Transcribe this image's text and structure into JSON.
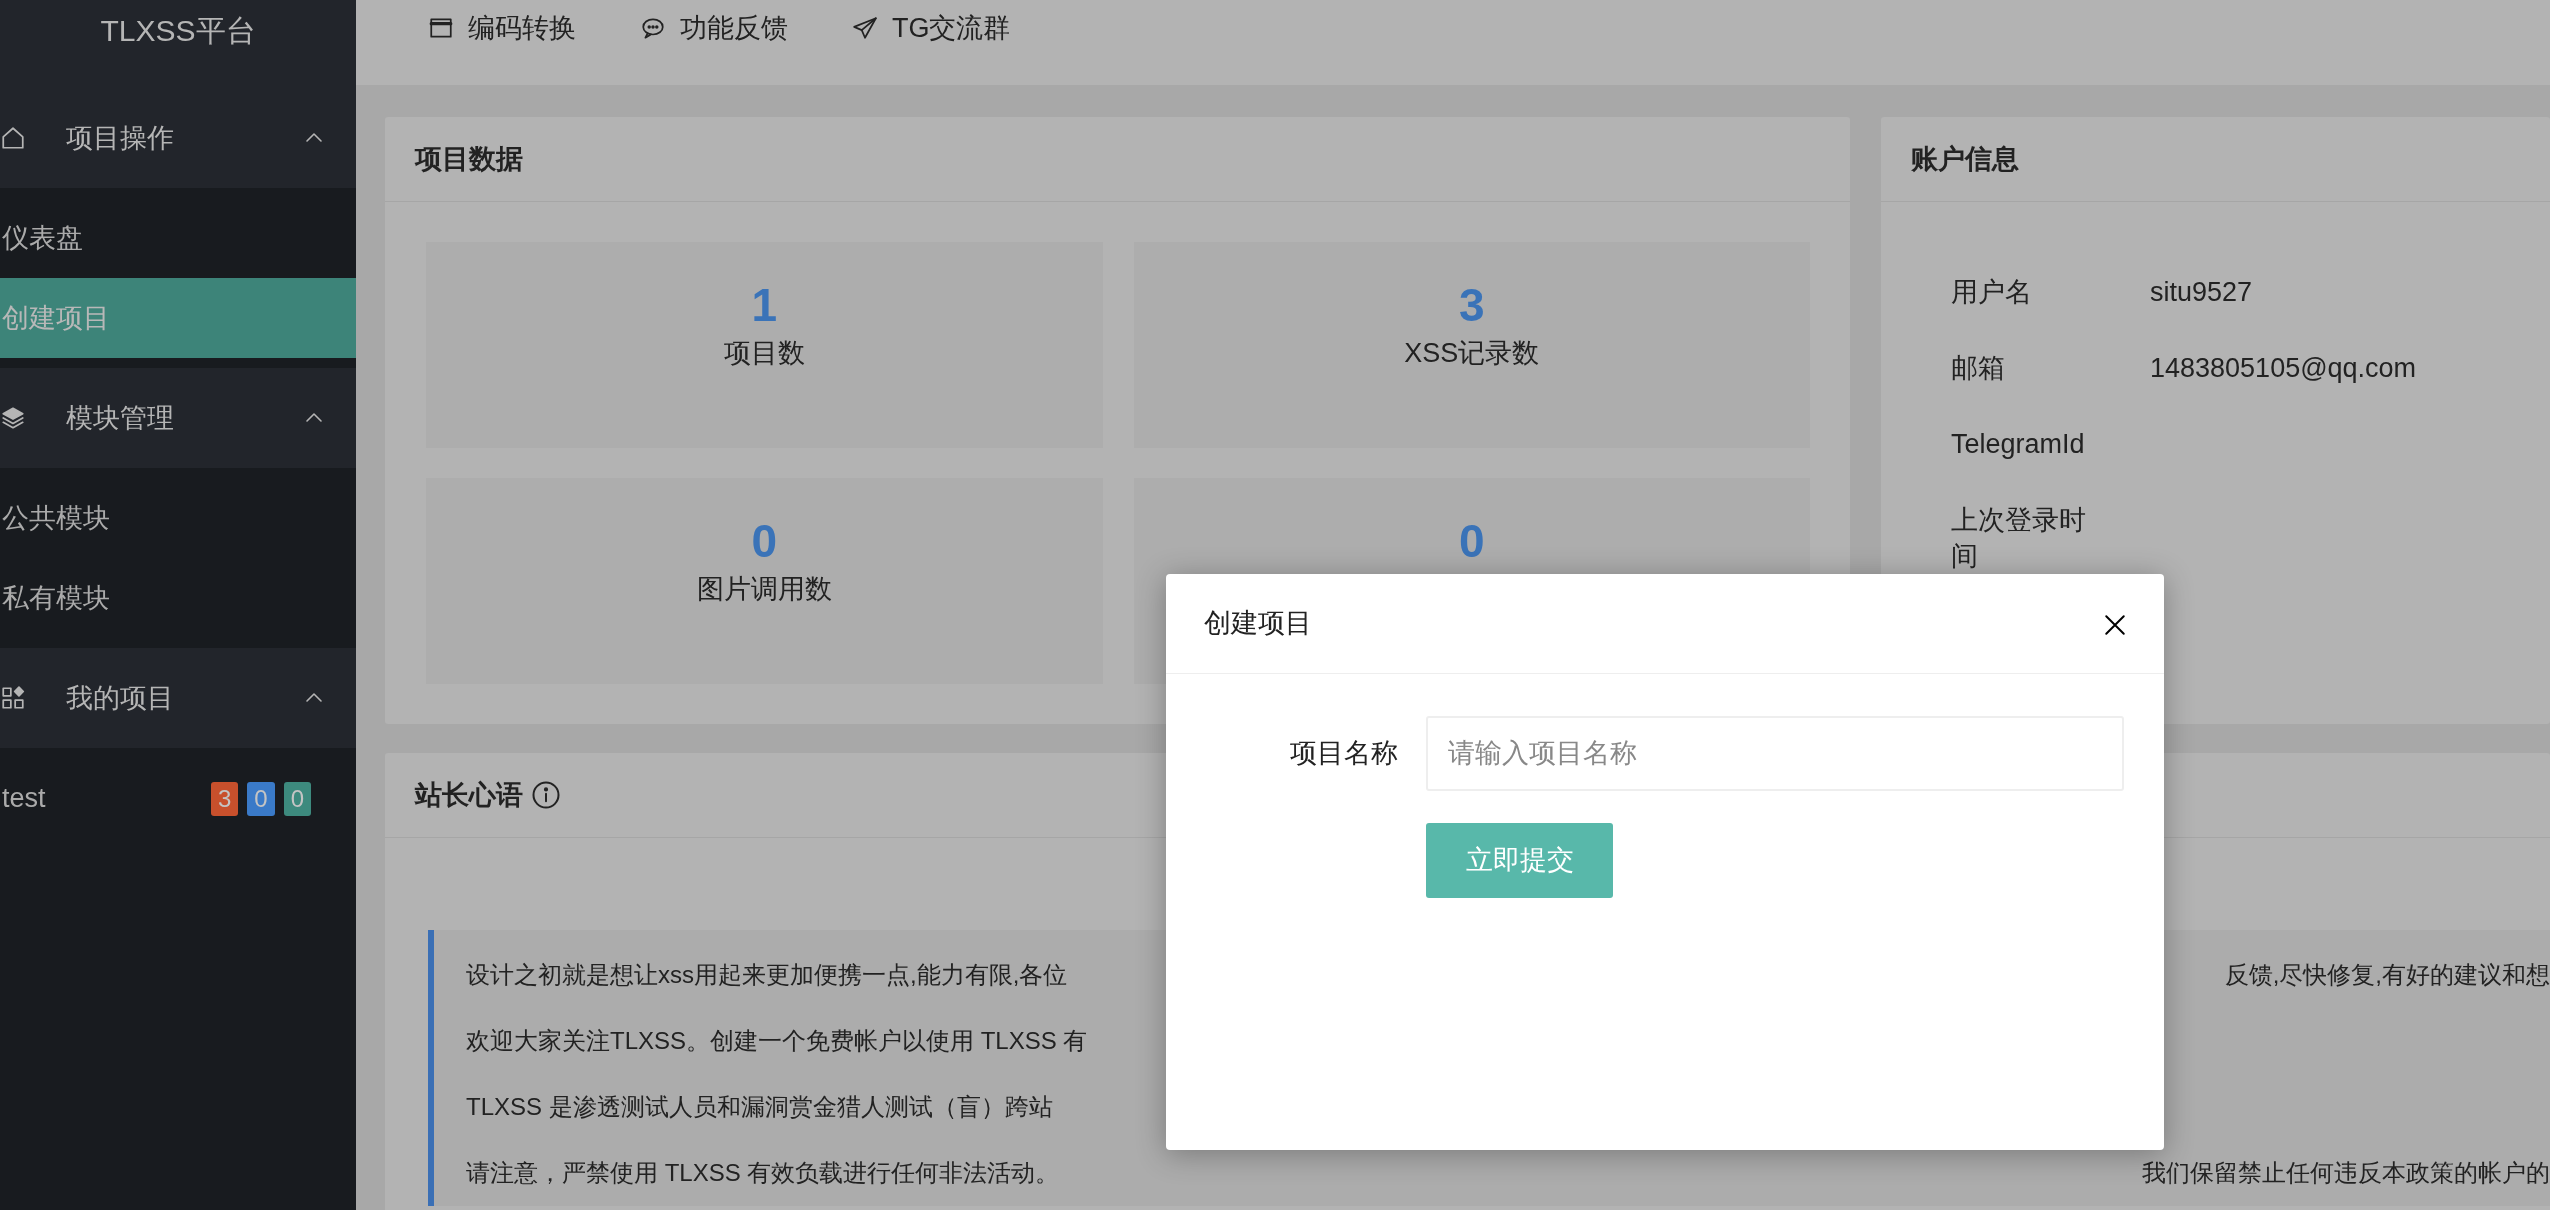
{
  "sidebar": {
    "logo": "TLXSS平台",
    "sections": [
      {
        "title": "项目操作",
        "expanded": true,
        "items": [
          {
            "label": "仪表盘",
            "selected": false
          },
          {
            "label": "创建项目",
            "selected": true
          }
        ]
      },
      {
        "title": "模块管理",
        "expanded": true,
        "items": [
          {
            "label": "公共模块",
            "selected": false
          },
          {
            "label": "私有模块",
            "selected": false
          }
        ]
      },
      {
        "title": "我的项目",
        "expanded": true,
        "items": [
          {
            "label": "test",
            "selected": false,
            "badges": [
              {
                "text": "3",
                "color": "#c8502c"
              },
              {
                "text": "0",
                "color": "#3a7ac8"
              },
              {
                "text": "0",
                "color": "#3d8a7e"
              }
            ]
          }
        ]
      }
    ]
  },
  "top_nav": [
    {
      "label": "编码转换"
    },
    {
      "label": "功能反馈"
    },
    {
      "label": "TG交流群"
    }
  ],
  "project_data": {
    "title": "项目数据",
    "stats": [
      {
        "value": "1",
        "label": "项目数"
      },
      {
        "value": "3",
        "label": "XSS记录数"
      },
      {
        "value": "0",
        "label": "图片调用数"
      },
      {
        "value": "0"
      }
    ]
  },
  "account_info": {
    "title": "账户信息",
    "rows": [
      {
        "label": "用户名",
        "value": "situ9527"
      },
      {
        "label": "邮箱",
        "value": "1483805105@qq.com"
      },
      {
        "label": "TelegramId"
      },
      {
        "label": "上次登录时间"
      }
    ]
  },
  "notice": {
    "title": "站长心语",
    "lines": [
      {
        "left": "设计之初就是想让xss用起来更加便携一点,能力有限,各位",
        "right": "反馈,尽快修复,有好的建议和想"
      },
      {
        "left": "欢迎大家关注TLXSS。创建一个免费帐户以使用 TLXSS 有"
      },
      {
        "left": "TLXSS 是渗透测试人员和漏洞赏金猎人测试（盲）跨站"
      },
      {
        "left": "请注意，严禁使用 TLXSS 有效负载进行任何非法活动。",
        "right": "我们保留禁止任何违反本政策的帐户的"
      }
    ]
  },
  "modal": {
    "title": "创建项目",
    "field": {
      "label": "项目名称",
      "placeholder": "请输入项目名称"
    },
    "submit": "立即提交"
  }
}
